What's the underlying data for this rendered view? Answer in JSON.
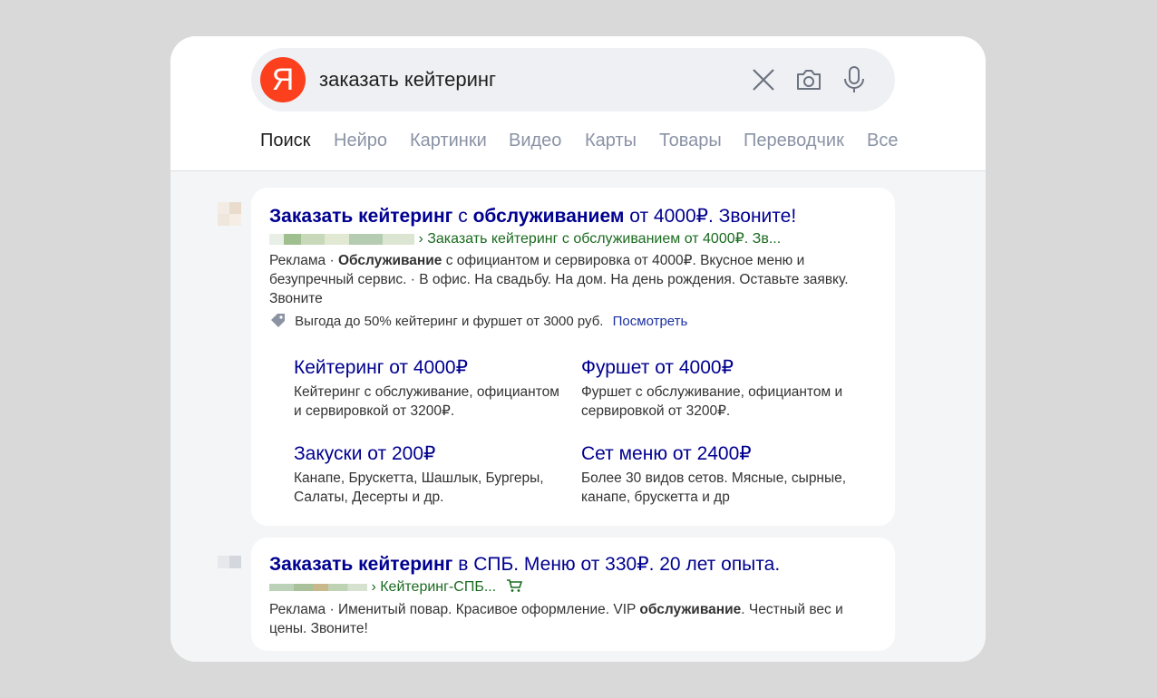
{
  "search": {
    "logo": "Я",
    "query": "заказать кейтеринг",
    "icons": [
      "clear-icon",
      "camera-icon",
      "microphone-icon"
    ]
  },
  "tabs": [
    "Поиск",
    "Нейро",
    "Картинки",
    "Видео",
    "Карты",
    "Товары",
    "Переводчик",
    "Все"
  ],
  "results": [
    {
      "title_bold1": "Заказать кейтеринг",
      "title_plain1": " с ",
      "title_bold2": "обслуживанием",
      "title_plain2": " от 4000₽. Звоните!",
      "breadcrumb": "Заказать кейтеринг с обслуживанием от 4000₽. Зв...",
      "desc_prefix": "Реклама · ",
      "desc_bold": "Обслуживание",
      "desc_rest": " с официантом и сервировка от 4000₽. Вкусное меню и безупречный сервис. · В офис. На свадьбу. На дом. На день рождения. Оставьте заявку. Звоните",
      "promo_text": "Выгода до 50% кейтеринг и фуршет от 3000 руб.",
      "promo_link": "Посмотреть",
      "sitelinks": [
        {
          "title": "Кейтеринг от 4000₽",
          "desc": "Кейтеринг с обслуживание, официантом и сервировкой от 3200₽."
        },
        {
          "title": "Фуршет от 4000₽",
          "desc": "Фуршет с обслуживание, официантом и сервировкой от 3200₽."
        },
        {
          "title": "Закуски от 200₽",
          "desc": "Канапе, Брускетта, Шашлык, Бургеры, Салаты, Десерты и др."
        },
        {
          "title": "Сет меню от 2400₽",
          "desc": "Более 30 видов сетов. Мясные, сырные, канапе, брускетта и др"
        }
      ]
    },
    {
      "title_bold1": "Заказать кейтеринг",
      "title_plain1": " в СПБ. Меню от 330₽. 20 лет опыта.",
      "breadcrumb": "Кейтеринг-СПБ...",
      "desc_prefix": "Реклама · Именитый повар. Красивое оформление. VIP ",
      "desc_bold": "обслуживание",
      "desc_rest": ". Честный вес и цены. Звоните!"
    }
  ],
  "colors": {
    "brand": "#fc3f1d",
    "link": "#000090",
    "url": "#1a6b1f"
  }
}
